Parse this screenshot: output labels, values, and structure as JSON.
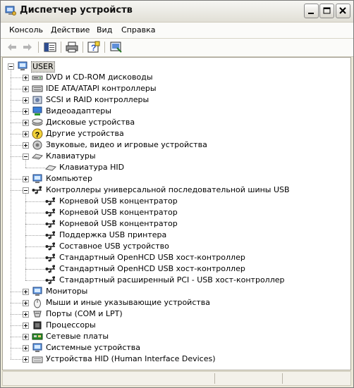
{
  "window": {
    "title": "Диспетчер устройств",
    "controls": {
      "minimize": "minimize",
      "maximize": "maximize",
      "close": "close"
    }
  },
  "menu": {
    "items": [
      "Консоль",
      "Действие",
      "Вид",
      "Справка"
    ]
  },
  "toolbar": {
    "buttons": [
      "back-arrow-icon",
      "forward-arrow-icon",
      "show-hide-tree-icon",
      "print-icon",
      "help-icon",
      "properties-icon"
    ]
  },
  "tree": {
    "root": "USER",
    "categories": [
      {
        "label": "DVD и CD-ROM дисководы",
        "icon": "cdrom-icon",
        "expanded": false
      },
      {
        "label": "IDE ATA/ATAPI контроллеры",
        "icon": "ide-controller-icon",
        "expanded": false
      },
      {
        "label": "SCSI и RAID контроллеры",
        "icon": "scsi-controller-icon",
        "expanded": false
      },
      {
        "label": "Видеоадаптеры",
        "icon": "video-adapter-icon",
        "expanded": false
      },
      {
        "label": "Дисковые устройства",
        "icon": "disk-drive-icon",
        "expanded": false
      },
      {
        "label": "Другие устройства",
        "icon": "unknown-device-icon",
        "expanded": false
      },
      {
        "label": "Звуковые, видео и игровые устройства",
        "icon": "sound-icon",
        "expanded": false
      },
      {
        "label": "Клавиатуры",
        "icon": "keyboard-icon",
        "expanded": true,
        "children": [
          "Клавиатура HID"
        ]
      },
      {
        "label": "Компьютер",
        "icon": "computer-icon",
        "expanded": false
      },
      {
        "label": "Контроллеры универсальной последовательной шины USB",
        "icon": "usb-icon",
        "expanded": true,
        "children": [
          "Корневой USB концентратор",
          "Корневой USB концентратор",
          "Корневой USB концентратор",
          "Поддержка USB принтера",
          "Составное USB устройство",
          "Стандартный OpenHCD USB хост-контроллер",
          "Стандартный OpenHCD USB хост-контроллер",
          "Стандартный расширенный PCI - USB хост-контроллер"
        ]
      },
      {
        "label": "Мониторы",
        "icon": "monitor-icon",
        "expanded": false
      },
      {
        "label": "Мыши и иные указывающие устройства",
        "icon": "mouse-icon",
        "expanded": false
      },
      {
        "label": "Порты (COM и LPT)",
        "icon": "port-icon",
        "expanded": false
      },
      {
        "label": "Процессоры",
        "icon": "processor-icon",
        "expanded": false
      },
      {
        "label": "Сетевые платы",
        "icon": "network-card-icon",
        "expanded": false
      },
      {
        "label": "Системные устройства",
        "icon": "system-device-icon",
        "expanded": false
      },
      {
        "label": "Устройства HID (Human Interface Devices)",
        "icon": "hid-icon",
        "expanded": false
      }
    ]
  },
  "colors": {
    "selection": "#d5d3cc",
    "frame": "#ece9d8"
  }
}
